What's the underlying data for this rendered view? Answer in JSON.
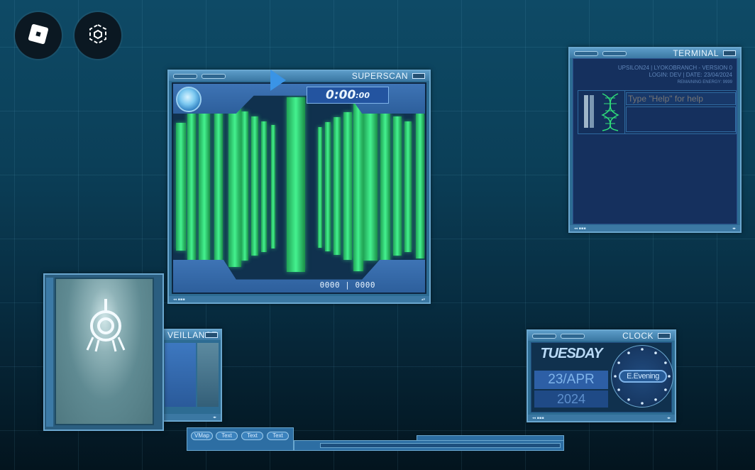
{
  "top_buttons": [
    {
      "icon": "roblox-logo-icon"
    },
    {
      "icon": "selection-cube-icon"
    }
  ],
  "superscan": {
    "title": "SUPERSCAN",
    "timer_main": "0:00",
    "timer_small": ":00",
    "counter": "0000 | 0000"
  },
  "terminal": {
    "title": "TERMINAL",
    "info_line1": "UPSILON24 | LYOKOBRANCH - VERSION 0",
    "info_line2": "LOGIN: DEV | DATE: 23/04/2024",
    "info_line3": "REMAINING ENERGY: 9999",
    "input_placeholder": "Type \"Help\" for help"
  },
  "surveillance": {
    "title": "VEILLANCE"
  },
  "clock": {
    "title": "CLOCK",
    "day": "TUESDAY",
    "date": "23/APR",
    "year": "2024",
    "period": "E.Evening"
  },
  "dock": {
    "buttons": [
      "VMap",
      "Text",
      "Text",
      "Text"
    ]
  },
  "colors": {
    "accent": "#3a94e6",
    "scan_green": "#44f28f",
    "window_frame": "#2d6c93"
  }
}
